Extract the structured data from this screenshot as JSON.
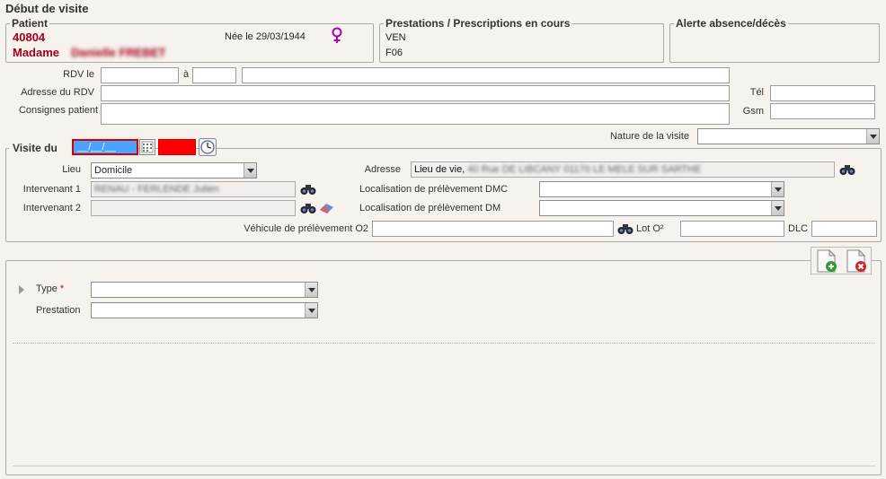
{
  "page_title": "Début de visite",
  "patient": {
    "legend": "Patient",
    "id": "40804",
    "salutation": "Madame",
    "name_blurred": "Danielle FREBET",
    "birth": "Née le 29/03/1944",
    "gender_icon": "female-symbol-icon"
  },
  "prestations": {
    "legend": "Prestations / Prescriptions en cours",
    "items": [
      "VEN",
      "F06"
    ]
  },
  "alerte": {
    "legend": "Alerte absence/décès"
  },
  "rdv": {
    "label": "RDV le",
    "a_label": "à",
    "adresse_label": "Adresse du RDV",
    "consignes_label": "Consignes patient",
    "tel_label": "Tél",
    "gsm_label": "Gsm"
  },
  "nature_visite": {
    "label": "Nature de la visite",
    "value": ""
  },
  "visite": {
    "legend": "Visite du",
    "date_value": "__/__/__",
    "lieu_label": "Lieu",
    "lieu_value": "Domicile",
    "adresse_label": "Adresse",
    "adresse_prefix": "Lieu de vie,",
    "adresse_blurred": "40 Rue DE LIBCANY 01170 LE MELE SUR SARTHE",
    "intervenant1_label": "Intervenant 1",
    "intervenant1_blurred": "RENAU - FERLENDE Julien",
    "intervenant2_label": "Intervenant 2",
    "dmc_label": "Localisation de prélèvement DMC",
    "dm_label": "Localisation de prélèvement DM",
    "vehicule_label": "Véhicule de prélèvement O2",
    "lot_label": "Lot O²",
    "dlc_label": "DLC"
  },
  "prestation_panel": {
    "type_label": "Type",
    "required_mark": "*",
    "prestation_label": "Prestation"
  },
  "colors": {
    "date_field_bg": "#4aa3ff",
    "time_field_bg": "#ff0000",
    "error_border": "#d10000",
    "patient_red": "#a3001a"
  }
}
